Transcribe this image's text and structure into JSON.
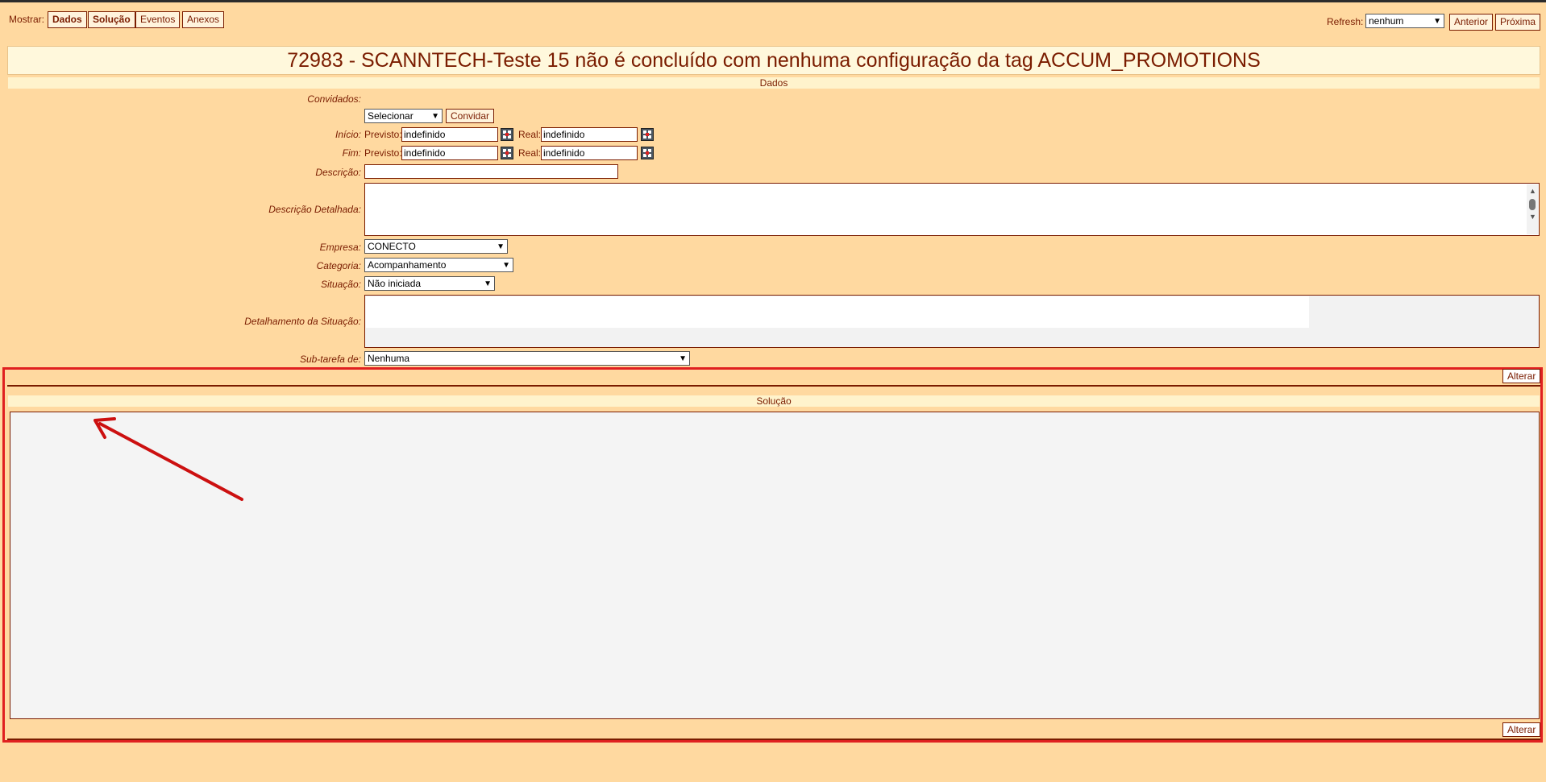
{
  "header": {
    "show_label": "Mostrar:",
    "tabs": [
      "Dados",
      "Solução",
      "Eventos",
      "Anexos"
    ],
    "refresh_label": "Refresh:",
    "refresh_value": "nenhum",
    "prev_label": "Anterior",
    "next_label": "Próxima"
  },
  "title": "72983 - SCANNTECH-Teste 15 não é concluído com nenhuma configuração da tag ACCUM_PROMOTIONS",
  "dados": {
    "section_title": "Dados",
    "convidados_label": "Convidados:",
    "convidar_select": "Selecionar",
    "convidar_button": "Convidar",
    "inicio_label": "Início:",
    "fim_label": "Fim:",
    "previsto_label": "Previsto:",
    "real_label": "Real:",
    "inicio_previsto": "indefinido",
    "inicio_real": "indefinido",
    "fim_previsto": "indefinido",
    "fim_real": "indefinido",
    "descricao_label": "Descrição:",
    "descricao_value": "",
    "descricao_detalhada_label": "Descrição Detalhada:",
    "empresa_label": "Empresa:",
    "empresa_value": "CONECTO",
    "categoria_label": "Categoria:",
    "categoria_value": "Acompanhamento",
    "situacao_label": "Situação:",
    "situacao_value": "Não iniciada",
    "detalhamento_label": "Detalhamento da Situação:",
    "subtarefa_label": "Sub-tarefa de:",
    "subtarefa_value": "Nenhuma"
  },
  "solucao": {
    "alterar_top": "Alterar",
    "section_title": "Solução",
    "alterar_bottom": "Alterar"
  },
  "colors": {
    "background": "#ffd9a0",
    "text": "#7a1c00",
    "highlight_border": "#e02020"
  },
  "icons": [
    "calendar-icon",
    "dropdown-arrow-icon",
    "annotation-arrow"
  ]
}
